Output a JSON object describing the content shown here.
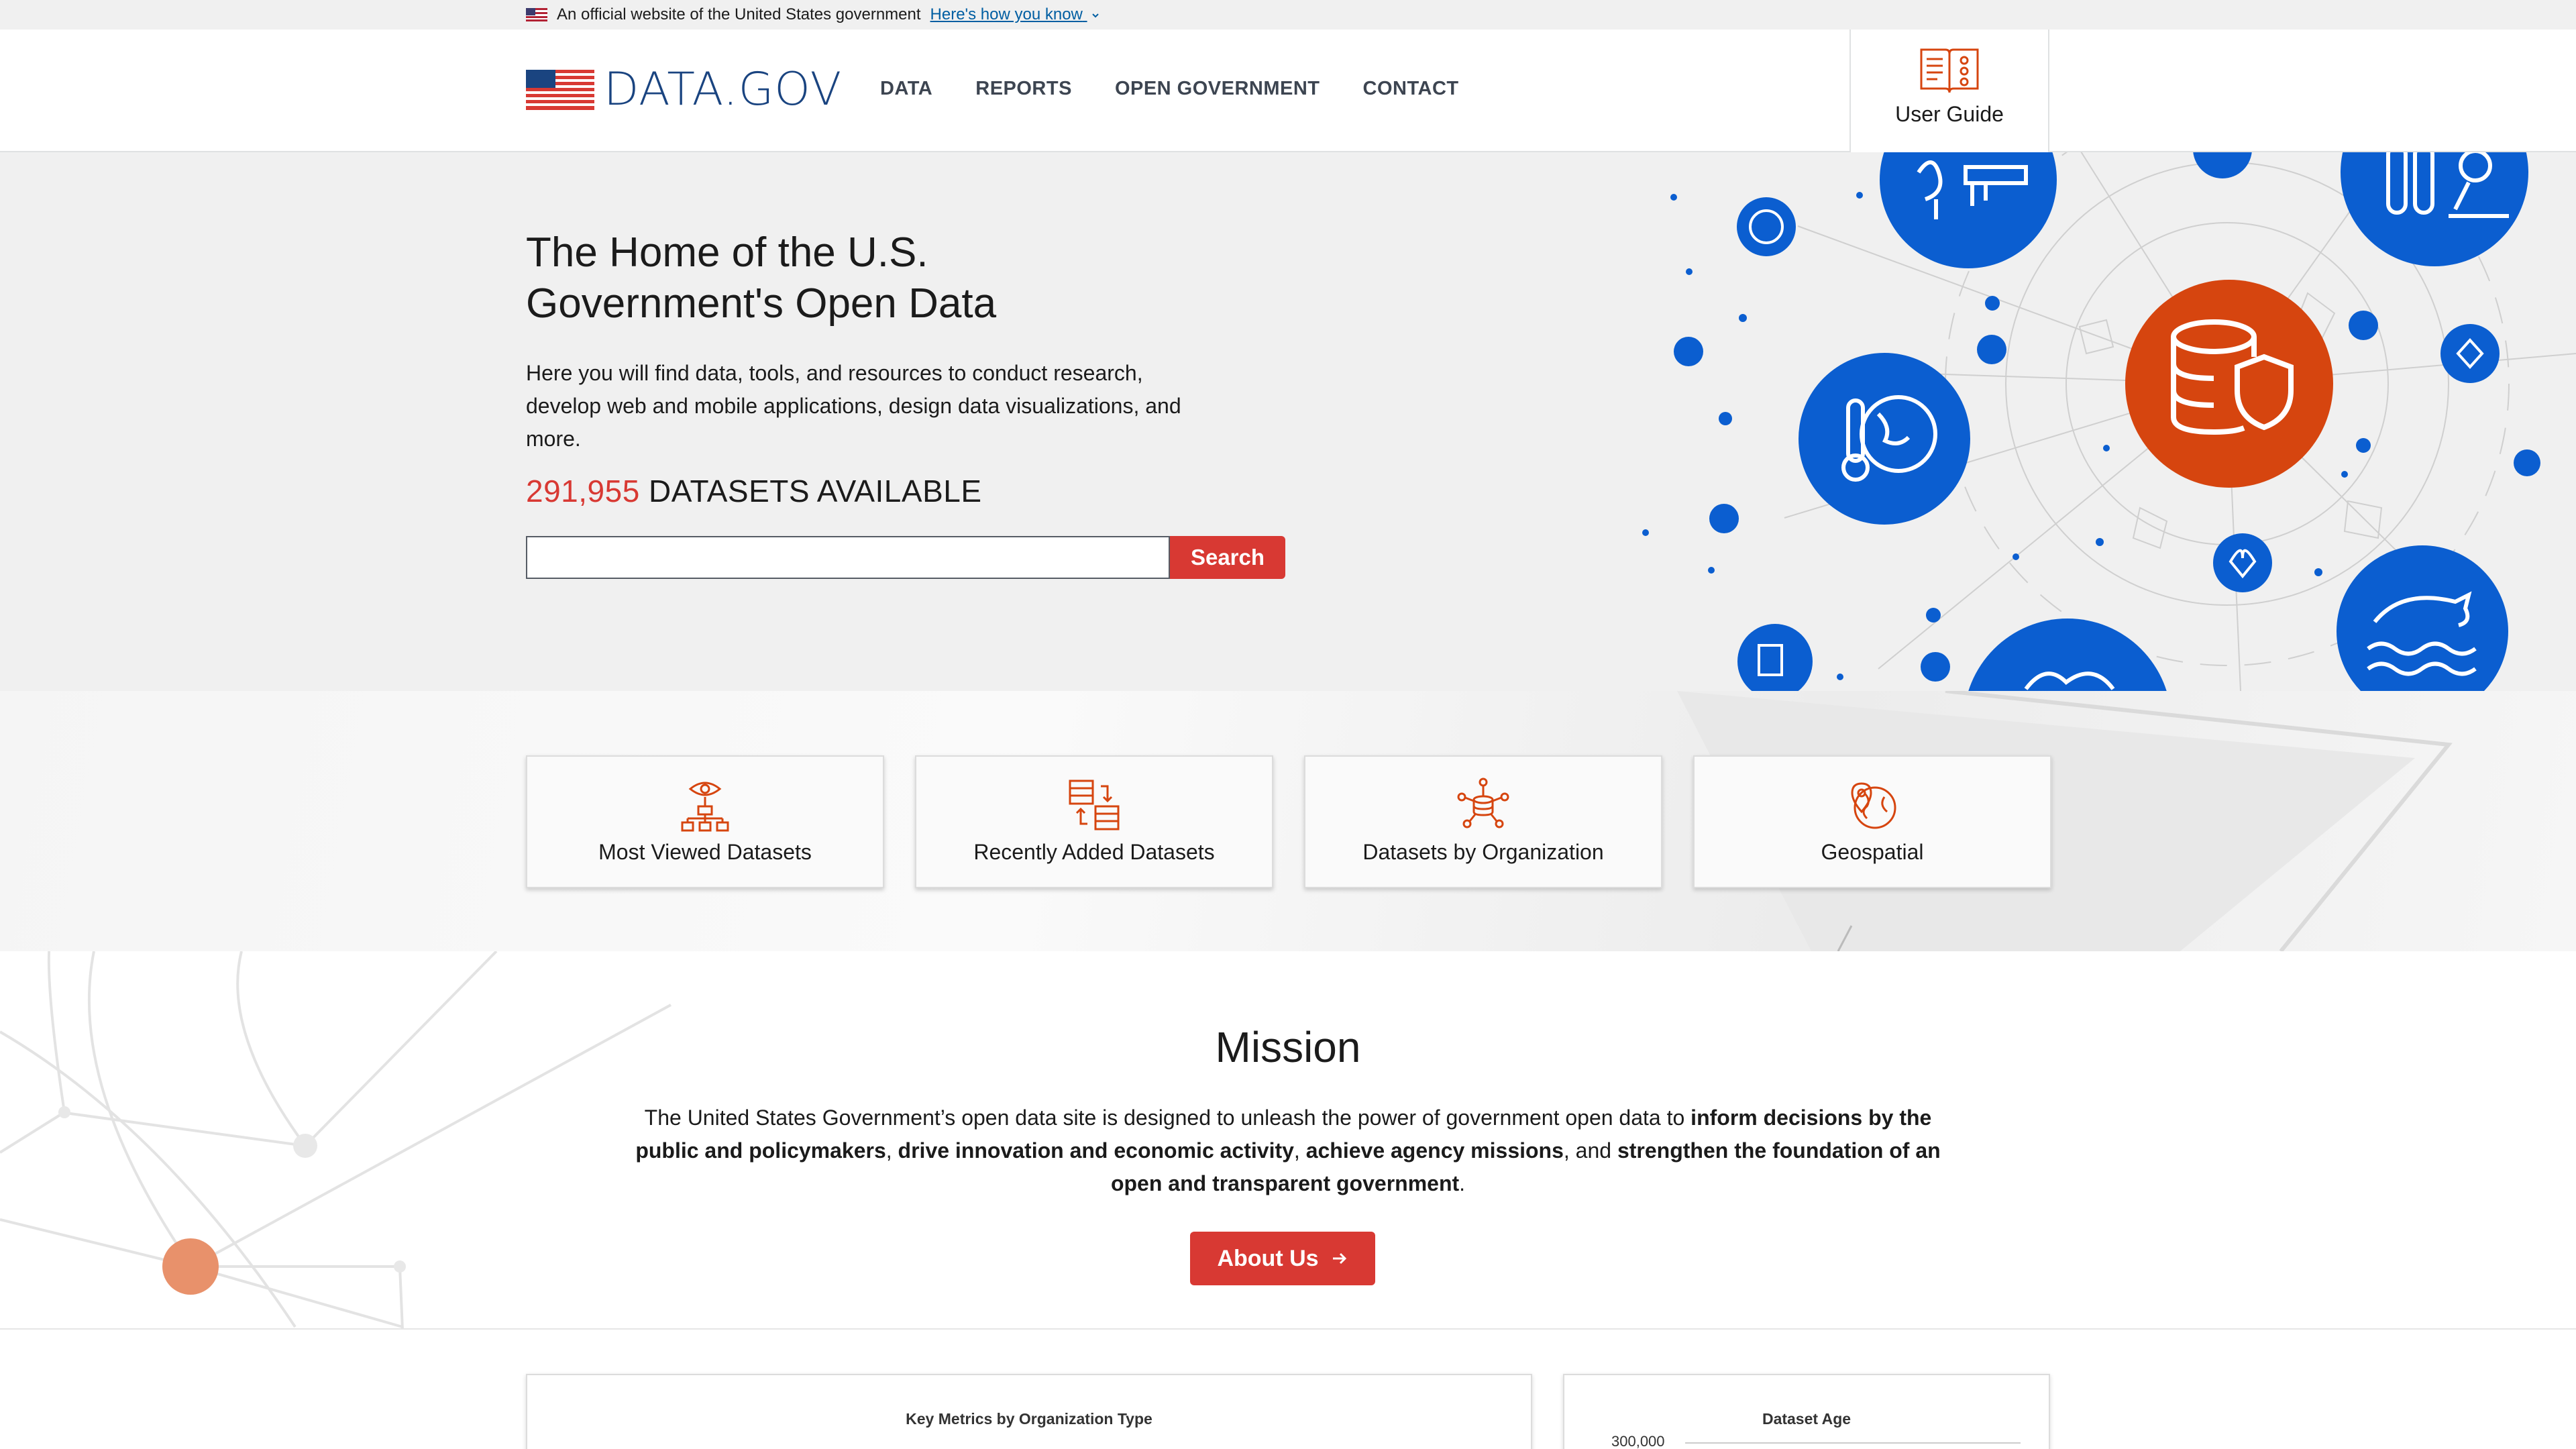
{
  "gov_banner": {
    "text": "An official website of the United States government",
    "link": "Here's how you know"
  },
  "header": {
    "logo_text": "DATA.GOV",
    "nav": [
      "DATA",
      "REPORTS",
      "OPEN GOVERNMENT",
      "CONTACT"
    ],
    "user_guide": "User Guide"
  },
  "hero": {
    "title_line1": "The Home of the U.S.",
    "title_line2": "Government's Open Data",
    "intro": "Here you will find data, tools, and resources to conduct research, develop web and mobile applications, design data visualizations, and more.",
    "dataset_count": "291,955",
    "dataset_suffix": " DATASETS AVAILABLE",
    "search_value": "",
    "search_button": "Search"
  },
  "quick_links": [
    {
      "label": "Most Viewed Datasets",
      "icon": "hierarchy-eye-icon"
    },
    {
      "label": "Recently Added Datasets",
      "icon": "tables-arrows-icon"
    },
    {
      "label": "Datasets by Organization",
      "icon": "network-database-icon"
    },
    {
      "label": "Geospatial",
      "icon": "globe-pin-icon"
    }
  ],
  "mission": {
    "title": "Mission",
    "p1": "The United States Government’s open data site is designed to unleash the power of government open data to ",
    "b1": "inform decisions by the public and policymakers",
    "p2": ", ",
    "b2": "drive innovation and economic activity",
    "p3": ", ",
    "b3": "achieve agency missions",
    "p4": ", and ",
    "b4": "strengthen the foundation of an open and transparent government",
    "p5": ".",
    "button": "About Us"
  },
  "metrics": {
    "card1_title": "Key Metrics by Organization Type",
    "card2_title": "Dataset Age",
    "card2_axis_tick": "300,000"
  },
  "colors": {
    "accent_red": "#d83933",
    "hero_orange": "#d6450f",
    "hero_blue": "#0b5ed0",
    "nav_text": "#3d4551",
    "link_blue": "#005ea2"
  }
}
